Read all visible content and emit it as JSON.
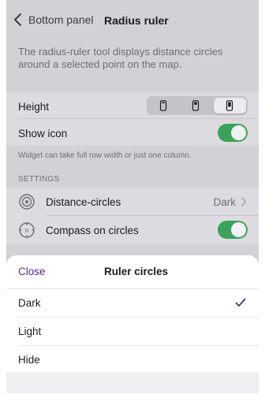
{
  "nav": {
    "back_label": "Bottom panel",
    "title": "Radius ruler"
  },
  "description": "The radius-ruler tool displays distance circles around a selected point on the map.",
  "height_row": {
    "label": "Height",
    "options": [
      "small-phone-icon",
      "medium-phone-icon",
      "large-phone-icon"
    ],
    "selected_index": 2
  },
  "show_icon_row": {
    "label": "Show icon",
    "enabled": true
  },
  "hint": "Widget can take full row width or just one column.",
  "settings": {
    "section_label": "SETTINGS",
    "distance_circles": {
      "label": "Distance-circles",
      "value": "Dark",
      "icon": "target-icon"
    },
    "compass": {
      "label": "Compass on circles",
      "enabled": true,
      "icon": "compass-icon"
    }
  },
  "sheet": {
    "close_label": "Close",
    "title": "Ruler circles",
    "options": [
      {
        "label": "Dark",
        "selected": true
      },
      {
        "label": "Light",
        "selected": false
      },
      {
        "label": "Hide",
        "selected": false
      }
    ]
  },
  "colors": {
    "accent": "#4b2a8a",
    "toggle_on": "#3aa35a",
    "backdrop": "#d2d2d6"
  }
}
